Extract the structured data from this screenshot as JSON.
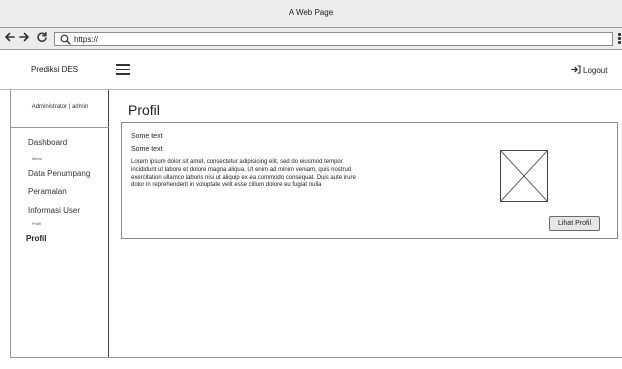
{
  "window": {
    "title": "A Web Page"
  },
  "browser": {
    "url": "https://"
  },
  "header": {
    "brand": "Prediksi DES",
    "logout_label": "Logout"
  },
  "sidebar": {
    "user": "Administrator | admin",
    "items": [
      {
        "label": "Dashboard"
      },
      {
        "label": "Menu",
        "small": true
      },
      {
        "label": "Data Penumpang"
      },
      {
        "label": "Peramalan"
      },
      {
        "label": "Informasi User"
      },
      {
        "label": "Profil",
        "small": true
      },
      {
        "label": "Profil",
        "bold": true
      }
    ]
  },
  "main": {
    "title": "Profil",
    "card": {
      "text1": "Some text",
      "text2": "Some text",
      "body": "Lorem ipsum dolor sit amet, consectetur adipisicing elit, sed do eiusmod tempor incididunt ut labore et dolore magna aliqua. Ut enim ad minim veniam, quis nostrud exercitation ullamco laboris nisi ut aliquip ex ea commodo consequat. Duis aute irure dolor in reprehenderit in voluptate velit esse cillum dolore eu fugiat nulla",
      "button_label": "Lihat Profil"
    }
  },
  "icons": {
    "back": "arrow-left-icon",
    "forward": "arrow-right-icon",
    "reload": "reload-icon",
    "search": "search-icon",
    "menu": "hamburger-icon",
    "logout": "logout-icon",
    "image": "image-placeholder-icon"
  }
}
